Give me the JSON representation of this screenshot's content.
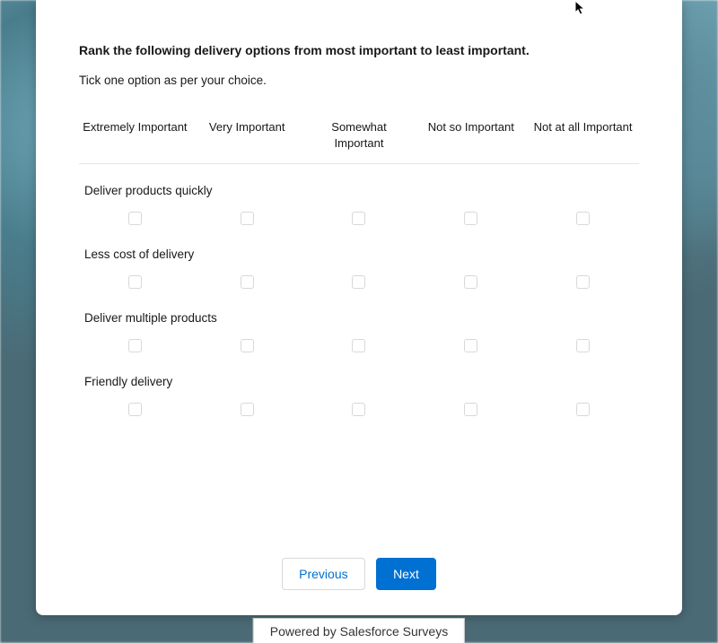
{
  "question": {
    "title": "Rank the following delivery options from most important to least important.",
    "instruction": "Tick one option as per your choice."
  },
  "columns": {
    "c0": "Extremely Important",
    "c1": "Very Important",
    "c2": "Somewhat Important",
    "c3": "Not so Important",
    "c4": "Not at all Important"
  },
  "rows": {
    "r0": "Deliver products quickly",
    "r1": "Less cost of delivery",
    "r2": "Deliver multiple products",
    "r3": "Friendly delivery"
  },
  "nav": {
    "previous": "Previous",
    "next": "Next"
  },
  "footer": "Powered by Salesforce Surveys"
}
